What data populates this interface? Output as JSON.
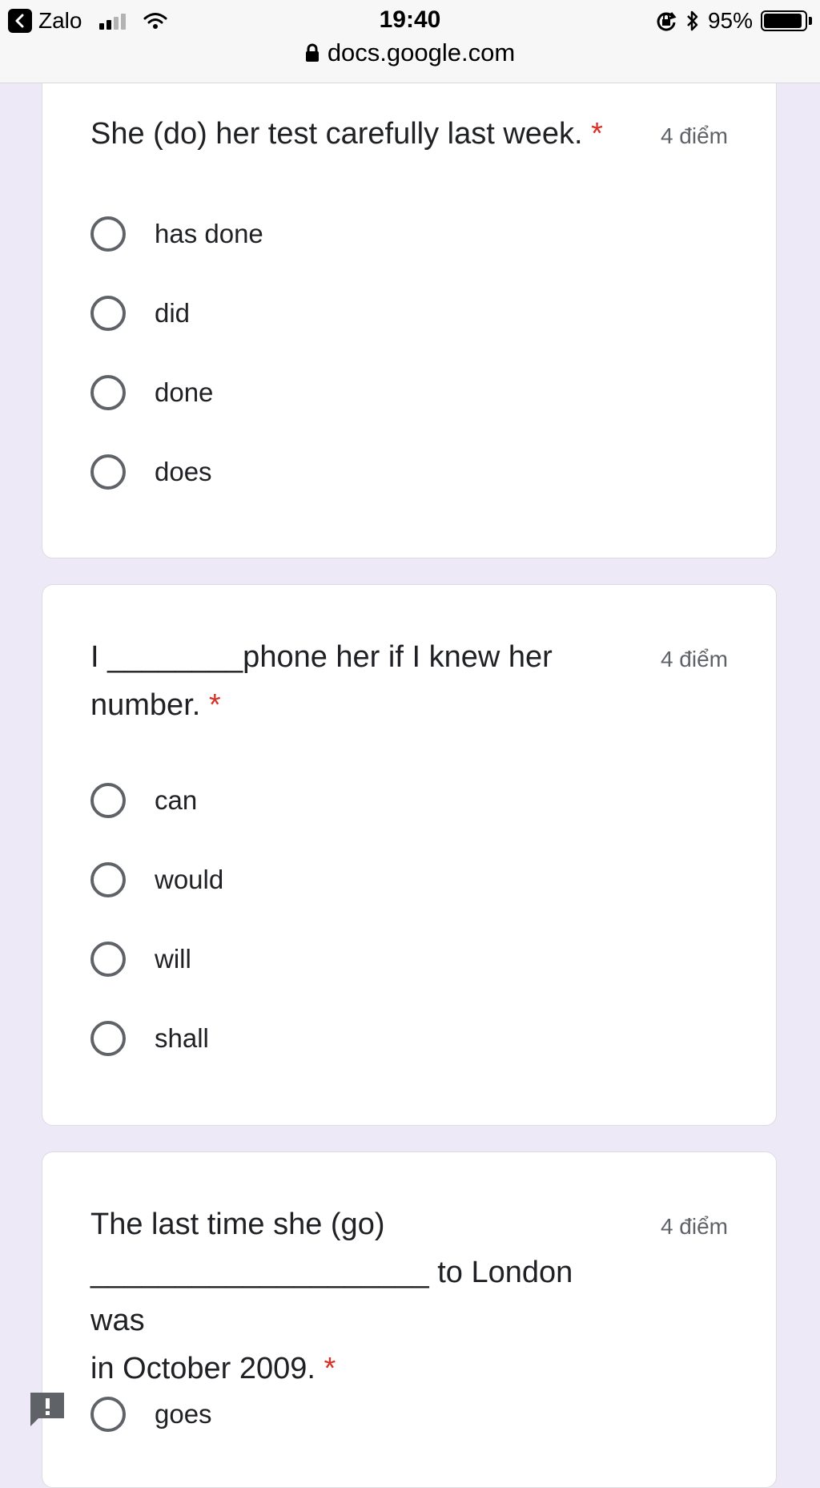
{
  "status_bar": {
    "back_app": "Zalo",
    "time": "19:40",
    "battery_percent": "95%",
    "battery_level": 0.95
  },
  "url_bar": {
    "domain": "docs.google.com"
  },
  "questions": [
    {
      "title": "She (do) her test carefully last week.",
      "required_mark": "*",
      "points": "4 điểm",
      "options": [
        "has done",
        "did",
        "done",
        "does"
      ]
    },
    {
      "title_line1": "I ________phone her if I knew her",
      "title_line2": "number.",
      "required_mark": "*",
      "points": "4 điểm",
      "options": [
        "can",
        "would",
        "will",
        "shall"
      ]
    },
    {
      "title_line1": "The last time she (go)",
      "title_line2": "____________________ to London was",
      "title_line3": "in October 2009.",
      "required_mark": "*",
      "points": "4 điểm",
      "options": [
        "goes"
      ]
    }
  ],
  "icons": {
    "back": "back-arrow-icon",
    "lock": "lock-icon",
    "wifi": "wifi-icon",
    "rotation_lock": "rotation-lock-icon",
    "bluetooth": "bluetooth-icon",
    "feedback": "feedback-icon"
  }
}
